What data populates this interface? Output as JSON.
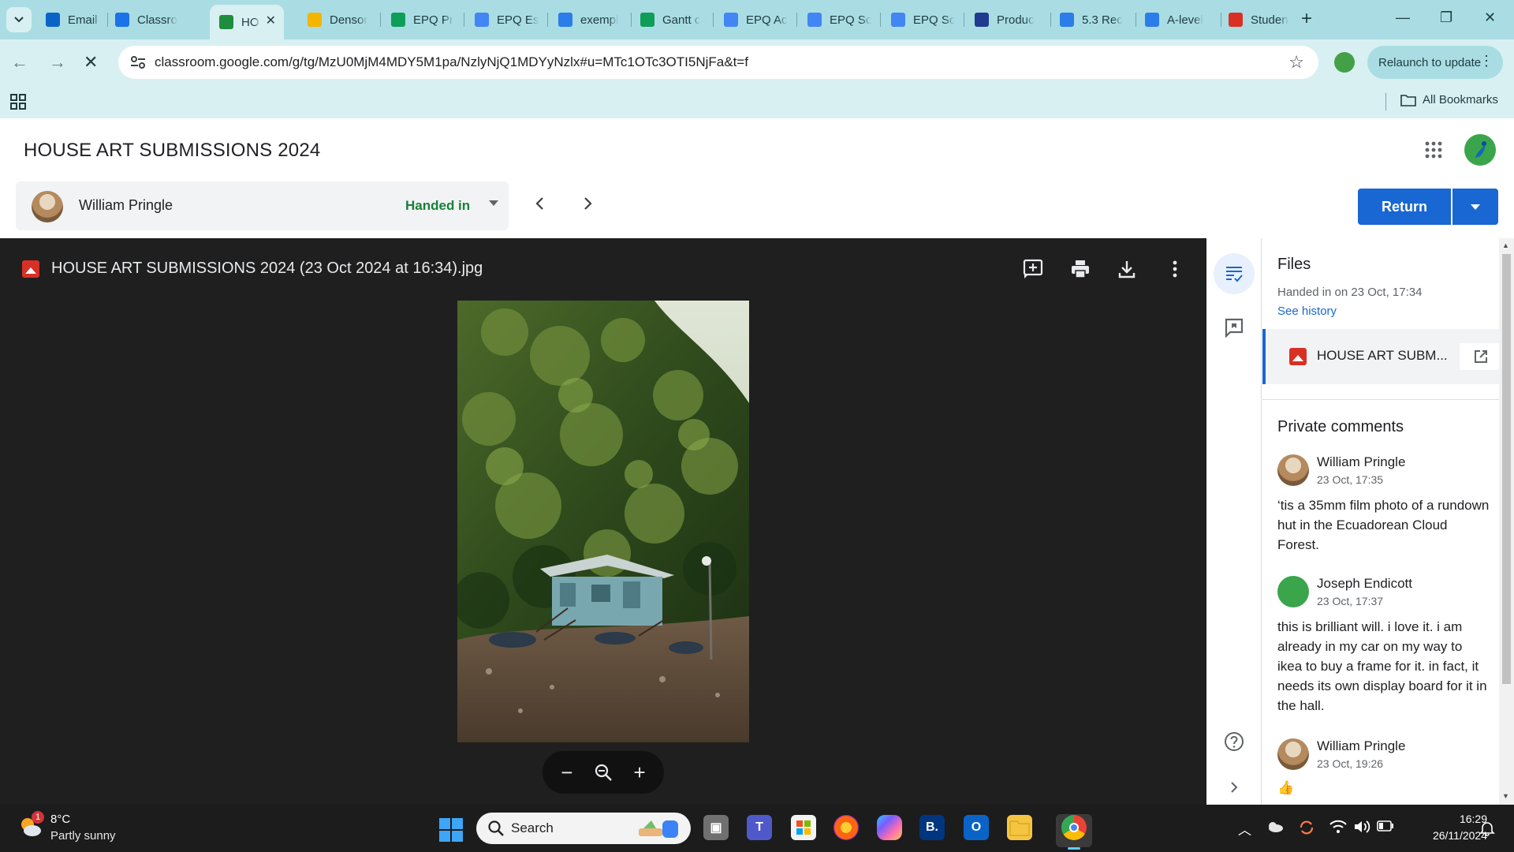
{
  "browser": {
    "tabs": [
      {
        "label": "Email -",
        "favicon": "outlook-icon",
        "color": "#0a64c8"
      },
      {
        "label": "Classro",
        "favicon": "classroom-person-icon",
        "color": "#1a73e8"
      },
      {
        "label": "HO",
        "favicon": "classroom-loading-icon",
        "color": "#1e8e3e",
        "active": true,
        "close": "✕"
      },
      {
        "label": "Densor",
        "favicon": "slides-icon",
        "color": "#f4b400"
      },
      {
        "label": "EPQ Pr",
        "favicon": "sheets-icon",
        "color": "#0f9d58"
      },
      {
        "label": "EPQ Es",
        "favicon": "docs-icon",
        "color": "#4285f4"
      },
      {
        "label": "exempl",
        "favicon": "pinterest-icon",
        "color": "#2b7de9"
      },
      {
        "label": "Gantt c",
        "favicon": "sheets-icon",
        "color": "#0f9d58"
      },
      {
        "label": "EPQ Ac",
        "favicon": "docs-icon",
        "color": "#4285f4"
      },
      {
        "label": "EPQ Sc",
        "favicon": "docs-icon",
        "color": "#4285f4"
      },
      {
        "label": "EPQ Sc",
        "favicon": "docs-icon",
        "color": "#4285f4"
      },
      {
        "label": "Produc",
        "favicon": "quizlet-icon",
        "color": "#203a8f"
      },
      {
        "label": "5.3 Rec",
        "favicon": "wordpress-w-icon",
        "color": "#2b7de9"
      },
      {
        "label": "A-level",
        "favicon": "wordpress-w-icon",
        "color": "#2b7de9"
      },
      {
        "label": "Studen",
        "favicon": "gift-red-icon",
        "color": "#d93025"
      }
    ],
    "new_tab": "+",
    "url": "classroom.google.com/g/tg/MzU0MjM4MDY5M1pa/NzlyNjQ1MDYyNzlx#u=MTc1OTc3OTI5NjFa&t=f",
    "relaunch_label": "Relaunch to update",
    "all_bookmarks": "All Bookmarks",
    "chrome_accent": "#a9dde3"
  },
  "classroom": {
    "title": "HOUSE ART SUBMISSIONS 2024",
    "student_name": "William Pringle",
    "status": "Handed in",
    "status_color": "#188038",
    "return_label": "Return",
    "accent": "#1967d2"
  },
  "viewer": {
    "file_name": "HOUSE ART SUBMISSIONS 2024 (23 Oct 2024 at 16:34).jpg",
    "tools": [
      "add-comment-icon",
      "print-icon",
      "download-icon",
      "more-vert-icon"
    ],
    "zoom_controls": [
      "zoom-out-icon",
      "zoom-reset-icon",
      "zoom-in-icon"
    ]
  },
  "side_panel": {
    "files_heading": "Files",
    "handed_in_text": "Handed in on 23 Oct, 17:34",
    "see_history": "See history",
    "file_label": "HOUSE ART SUBM...",
    "private_comments_heading": "Private comments",
    "comments": [
      {
        "author": "William Pringle",
        "date": "23 Oct, 17:35",
        "text": "‘tis a 35mm film photo of a rundown hut in the Ecuadorean Cloud Forest."
      },
      {
        "author": "Joseph Endicott",
        "date": "23 Oct, 17:37",
        "text": "this is brilliant will. i love it. i am already in my car on my way to ikea to buy a frame for it. in fact, it needs its own display board for it in the hall."
      },
      {
        "author": "William Pringle",
        "date": "23 Oct, 19:26",
        "text": "👍"
      }
    ]
  },
  "taskbar": {
    "weather_badge": "1",
    "temperature": "8°C",
    "condition": "Partly sunny",
    "search_label": "Search",
    "apps": [
      "task-view-icon",
      "teams-icon",
      "store-icon",
      "firefox-icon",
      "copilot-icon",
      "booking-b-icon",
      "outlook-icon",
      "file-explorer-icon",
      "chrome-icon"
    ],
    "booking_letter": "B.",
    "time": "16:29",
    "date": "26/11/2024"
  }
}
